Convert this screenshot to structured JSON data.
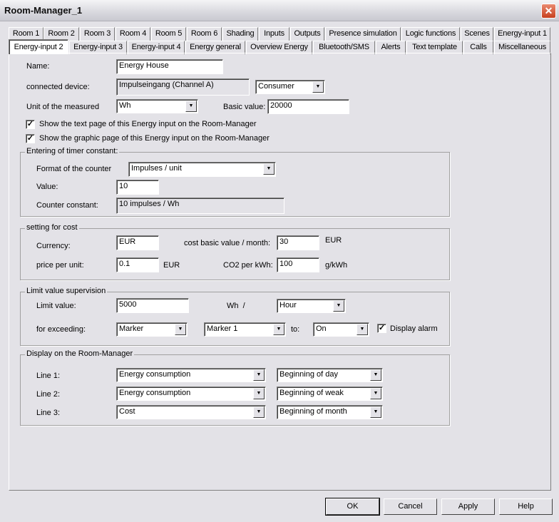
{
  "window": {
    "title": "Room-Manager_1",
    "close_icon": "close-icon"
  },
  "tabs_row1": [
    "Room 1",
    "Room 2",
    "Room 3",
    "Room 4",
    "Room 5",
    "Room 6",
    "Shading",
    "Inputs",
    "Outputs",
    "Presence simulation",
    "Logic functions",
    "Scenes",
    "Energy-input 1"
  ],
  "tabs_row2": [
    "Energy-input 2",
    "Energy-input 3",
    "Energy-input 4",
    "Energy general",
    "Overview Energy",
    "Bluetooth/SMS",
    "Alerts",
    "Text template",
    "Calls",
    "Miscellaneous"
  ],
  "active_tab": "Energy-input 2",
  "general": {
    "name_label": "Name:",
    "name_value": "Energy House",
    "device_label": "connected device:",
    "device_value": "Impulseingang  (Channel A)",
    "device_type": "Consumer",
    "unit_label": "Unit of the measured",
    "unit_value": "Wh",
    "basic_label": "Basic value:",
    "basic_value": "20000",
    "show_text": "Show the text page of this Energy input on the Room-Manager",
    "show_text_checked": true,
    "show_graphic": "Show the graphic page of this Energy input on the Room-Manager",
    "show_graphic_checked": true
  },
  "timer": {
    "title": "Entering of timer constant:",
    "format_label": "Format of the counter",
    "format_value": "Impulses / unit",
    "value_label": "Value:",
    "value": "10",
    "constant_label": "Counter constant:",
    "constant_value": "10 impulses / Wh"
  },
  "cost": {
    "title": "setting for cost",
    "currency_label": "Currency:",
    "currency": "EUR",
    "basic_label": "cost basic value / month:",
    "basic": "30",
    "basic_unit": "EUR",
    "price_label": "price per unit:",
    "price": "0.1",
    "price_unit": "EUR",
    "co2_label": "CO2 per kWh:",
    "co2": "100",
    "co2_unit": "g/kWh"
  },
  "limit": {
    "title": "Limit value supervision",
    "limit_label": "Limit value:",
    "limit": "5000",
    "unit": "Wh  /",
    "period": "Hour",
    "exceed_label": "for exceeding:",
    "type": "Marker",
    "target": "Marker 1",
    "to_label": "to:",
    "state": "On",
    "alarm_label": "Display alarm",
    "alarm_checked": true
  },
  "display": {
    "title": "Display on the Room-Manager",
    "lines": [
      {
        "label": "Line 1:",
        "value": "Energy consumption",
        "period": "Beginning of day"
      },
      {
        "label": "Line 2:",
        "value": "Energy consumption",
        "period": "Beginning of weak"
      },
      {
        "label": "Line 3:",
        "value": "Cost",
        "period": "Beginning of month"
      }
    ]
  },
  "buttons": {
    "ok": "OK",
    "cancel": "Cancel",
    "apply": "Apply",
    "help": "Help"
  }
}
